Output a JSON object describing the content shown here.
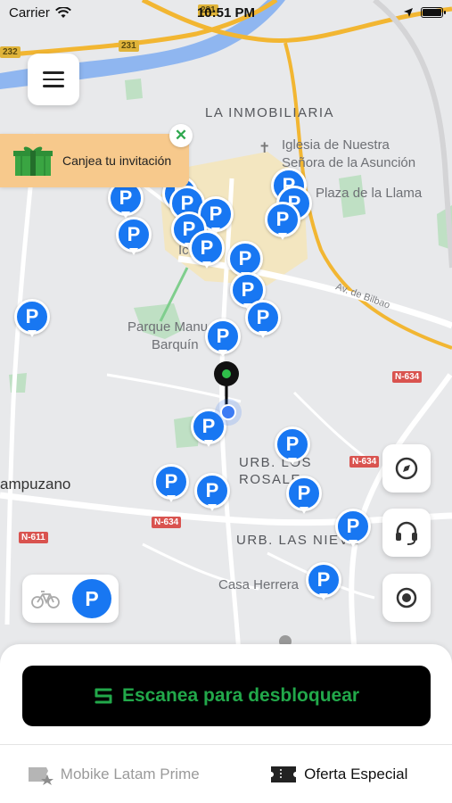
{
  "status_bar": {
    "carrier": "Carrier",
    "time": "10:51 PM"
  },
  "map": {
    "labels": {
      "la_inmobiliaria": "LA INMOBILIARIA",
      "iglesia": "Iglesia de Nuestra",
      "iglesia_2": "Señora de la Asunción",
      "plaza_llama": "Plaza de la Llama",
      "av_bilbao": "Av. de Bilbao",
      "parque": "Parque Manu",
      "parque_2": "Barquín",
      "urb_los": "URB. LOS",
      "urb_rosales": "ROSALE",
      "campuzano": "ampuzano",
      "urb_nieves": "URB. LAS NIEVE",
      "casa_herrera": "Casa Herrera",
      "town_partial": "Ic"
    },
    "road_signs": {
      "n634_a": "N-634",
      "n634_b": "N-634",
      "n634_c": "N-634",
      "n611": "N-611",
      "r231_a": "231",
      "r231_b": "231",
      "r232": "232"
    },
    "parking_marker_letter": "P",
    "colors": {
      "parking_blue": "#1877f2",
      "highway_yellow": "#f2b632",
      "river_blue": "#8fb6f0",
      "park_green": "#bfe0c4"
    }
  },
  "menu_button": {
    "icon": "hamburger-menu-icon"
  },
  "invite_banner": {
    "label": "Canjea tu invitación",
    "close_glyph": "✕"
  },
  "map_controls": {
    "compass": "compass-icon",
    "support": "headset-icon",
    "locate": "locate-icon"
  },
  "filter": {
    "bike_icon": "bicycle-icon",
    "parking_label": "P"
  },
  "scan_button": {
    "label": "Escanea para desbloquear",
    "accent": "#22a84a"
  },
  "tabs": [
    {
      "label": "Mobike Latam Prime",
      "icon": "ticket-star-icon",
      "active": false
    },
    {
      "label": "Oferta Especial",
      "icon": "coupon-icon",
      "active": true
    }
  ]
}
